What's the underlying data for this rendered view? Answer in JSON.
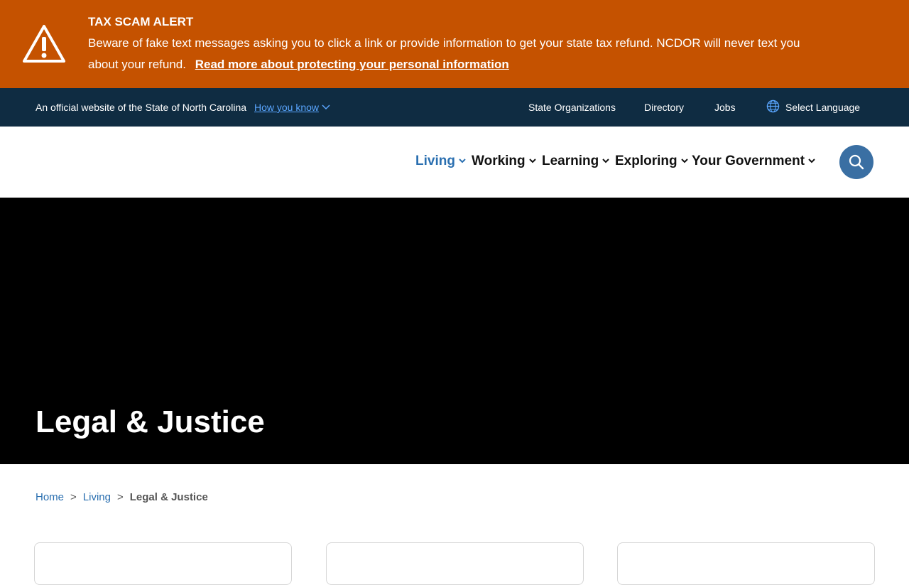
{
  "alert": {
    "title": "TAX SCAM ALERT",
    "body": "Beware of fake text messages asking you to click a link or provide information to get your state tax refund. NCDOR will never text you about your refund.",
    "link": "Read more about protecting your personal information",
    "icon": "warning-triangle-icon",
    "background_color": "#c55200"
  },
  "official_bar": {
    "text": "An official website of the State of North Carolina",
    "how_you_know": "How you know",
    "links": {
      "state_organizations": "State Organizations",
      "directory": "Directory",
      "jobs": "Jobs",
      "select_language": "Select Language"
    },
    "background_color": "#0f2c42"
  },
  "nav": {
    "items": [
      {
        "label": "Living",
        "active": true
      },
      {
        "label": "Working",
        "active": false
      },
      {
        "label": "Learning",
        "active": false
      },
      {
        "label": "Exploring",
        "active": false
      },
      {
        "label": "Your Government",
        "active": false
      }
    ],
    "active_color": "#2a6fb0",
    "search_icon": "search-icon"
  },
  "hero": {
    "title": "Legal & Justice"
  },
  "breadcrumb": {
    "items": [
      "Home",
      "Living"
    ],
    "separator": ">",
    "current": "Legal & Justice"
  }
}
